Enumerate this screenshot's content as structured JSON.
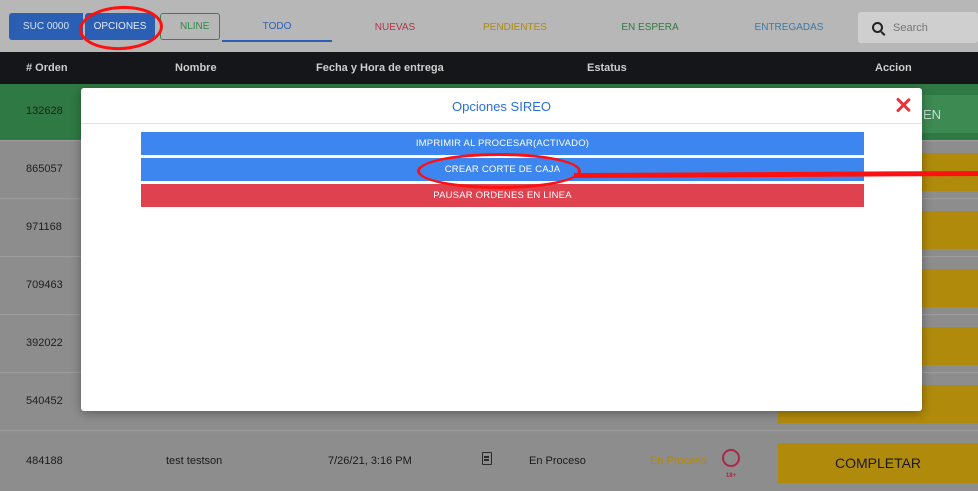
{
  "topbar": {
    "suc_label": "SUC 0000",
    "opciones_label": "OPCIONES",
    "online_label": "NLINE",
    "tabs": [
      {
        "label": "TODO",
        "color": "#2a5fb3"
      },
      {
        "label": "NUEVAS",
        "color": "#b53249"
      },
      {
        "label": "PENDIENTES",
        "color": "#b08a0b"
      },
      {
        "label": "EN ESPERA",
        "color": "#2f7a44"
      },
      {
        "label": "ENTREGADAS",
        "color": "#3d78a8"
      }
    ],
    "search_placeholder": "Search"
  },
  "table": {
    "headers": [
      "# Orden",
      "Nombre",
      "Fecha y Hora de entrega",
      "Estatus",
      "Accion"
    ],
    "rows": [
      {
        "order": "132628",
        "action": "EN"
      },
      {
        "order": "865057"
      },
      {
        "order": "971168"
      },
      {
        "order": "709463"
      },
      {
        "order": "392022"
      },
      {
        "order": "540452"
      }
    ],
    "last_row": {
      "order": "484188",
      "name": "test testson",
      "datetime": "7/26/21, 3:16 PM",
      "status": "En Proceso",
      "status_tag": "En Proceso",
      "age_badge": "18+",
      "action": "COMPLETAR"
    }
  },
  "modal": {
    "title": "Opciones SIREO",
    "buttons": [
      "IMPRIMIR AL PROCESAR(ACTIVADO)",
      "CREAR CORTE DE CAJA",
      "PAUSAR ORDENES EN LINEA"
    ]
  },
  "colors": {
    "primary": "#3d86ef",
    "danger": "#e0414f",
    "annotation": "#ff1010"
  }
}
